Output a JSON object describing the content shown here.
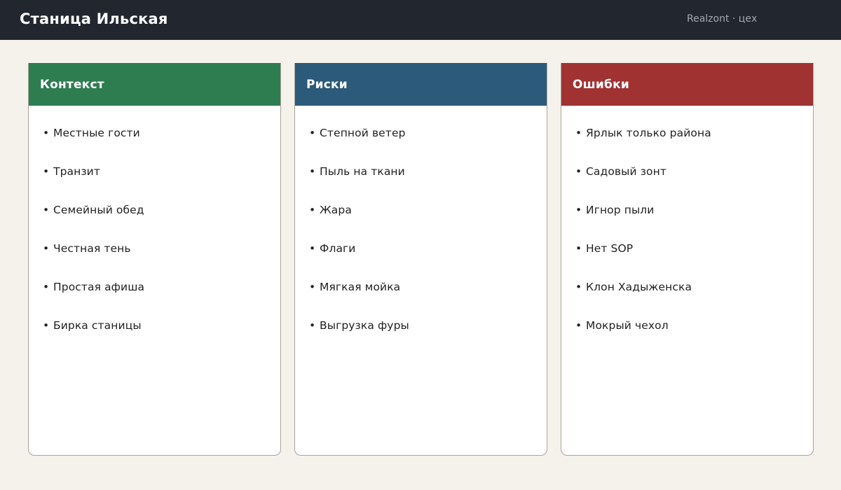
{
  "header": {
    "title": "Станица Ильская",
    "brand": "Realzont · цех"
  },
  "columns": [
    {
      "title": "Контекст",
      "color": "#2e7d51",
      "items": [
        "Местные гости",
        "Транзит",
        "Семейный обед",
        "Честная тень",
        "Простая афиша",
        "Бирка станицы"
      ]
    },
    {
      "title": "Риски",
      "color": "#2c5a7a",
      "items": [
        "Степной ветер",
        "Пыль на ткани",
        "Жара",
        "Флаги",
        "Мягкая мойка",
        "Выгрузка фуры"
      ]
    },
    {
      "title": "Ошибки",
      "color": "#a03232",
      "items": [
        "Ярлык только района",
        "Садовый зонт",
        "Игнор пыли",
        "Нет SOP",
        "Клон Хадыженска",
        "Мокрый чехол"
      ]
    }
  ],
  "bullet": "•"
}
